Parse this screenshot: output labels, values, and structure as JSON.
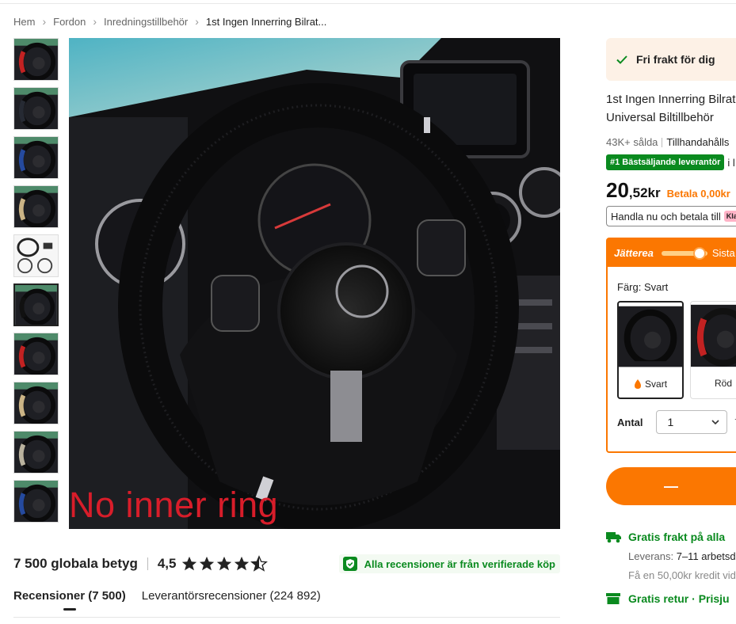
{
  "colors": {
    "accent": "#fb7701",
    "green": "#0a8a1f",
    "overlay_red": "#d81d2a"
  },
  "breadcrumb": [
    "Hem",
    "Fordon",
    "Inredningstillbehör",
    "1st Ingen Innerring Bilrat..."
  ],
  "gallery": {
    "thumbnails": [
      {
        "ring": "#c22222"
      },
      {
        "ring": "#262a33"
      },
      {
        "ring": "#254a9e"
      },
      {
        "ring": "#cbb486"
      },
      {
        "ring": "#333333"
      },
      {
        "ring": "#111111"
      },
      {
        "ring": "#c22222"
      },
      {
        "ring": "#cbb486"
      },
      {
        "ring": "#b9b29e"
      },
      {
        "ring": "#254a9e"
      }
    ],
    "active_index": 5,
    "overlay_text": "No inner ring"
  },
  "ratings": {
    "global": "7 500 globala betyg",
    "score": "4,5",
    "stars": 4.5,
    "verified": "Alla recensioner är från verifierade köp"
  },
  "reviews_tabs": [
    "Recensioner (7 500)",
    "Leverantörsrecensioner (224 892)"
  ],
  "right": {
    "free_shipping": "Fri frakt för dig",
    "title_line1": "1st Ingen Innerring Bilrat",
    "title_line2": "Universal Biltillbehör",
    "sold": "43K+ sålda",
    "supplier": "Tillhandahålls",
    "badge": "#1 Bästsäljande leverantör",
    "badge_suffix": "i l",
    "price_int": "20",
    "price_dec": ",52kr",
    "pay_later": "Betala 0,00kr",
    "klarna_text": "Handla nu och betala till",
    "klarna_brand": "Kla",
    "deal_brand": "Jätterea",
    "deal_last": "Sista",
    "color_label": "Färg: Svart",
    "swatches": [
      "Svart",
      "Röd"
    ],
    "qty_label": "Antal",
    "qty_value": "1",
    "qty_extra": "T",
    "cart_symbol": "—",
    "shipping_title": "Gratis frakt på alla",
    "delivery_label": "Leverans:",
    "delivery_value": "7–11 arbetsd",
    "credit": "Få en 50,00kr kredit vid",
    "returns": "Gratis retur · Prisju"
  }
}
